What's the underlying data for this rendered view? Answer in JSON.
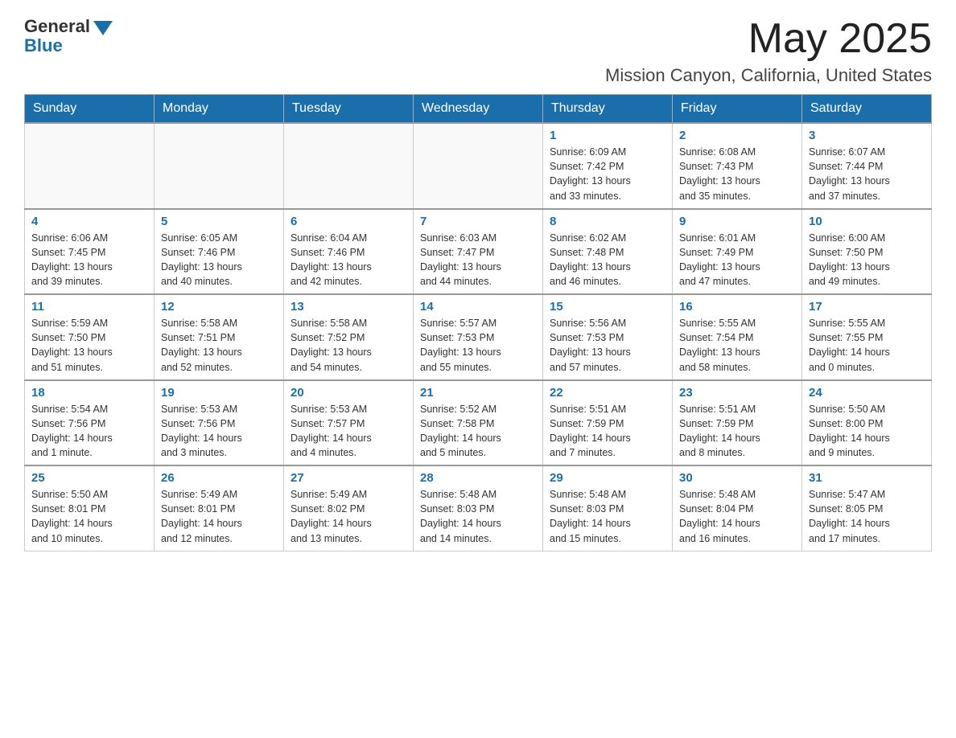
{
  "logo": {
    "general": "General",
    "blue": "Blue"
  },
  "header": {
    "month": "May 2025",
    "location": "Mission Canyon, California, United States"
  },
  "weekdays": [
    "Sunday",
    "Monday",
    "Tuesday",
    "Wednesday",
    "Thursday",
    "Friday",
    "Saturday"
  ],
  "weeks": [
    [
      {
        "day": "",
        "info": ""
      },
      {
        "day": "",
        "info": ""
      },
      {
        "day": "",
        "info": ""
      },
      {
        "day": "",
        "info": ""
      },
      {
        "day": "1",
        "info": "Sunrise: 6:09 AM\nSunset: 7:42 PM\nDaylight: 13 hours\nand 33 minutes."
      },
      {
        "day": "2",
        "info": "Sunrise: 6:08 AM\nSunset: 7:43 PM\nDaylight: 13 hours\nand 35 minutes."
      },
      {
        "day": "3",
        "info": "Sunrise: 6:07 AM\nSunset: 7:44 PM\nDaylight: 13 hours\nand 37 minutes."
      }
    ],
    [
      {
        "day": "4",
        "info": "Sunrise: 6:06 AM\nSunset: 7:45 PM\nDaylight: 13 hours\nand 39 minutes."
      },
      {
        "day": "5",
        "info": "Sunrise: 6:05 AM\nSunset: 7:46 PM\nDaylight: 13 hours\nand 40 minutes."
      },
      {
        "day": "6",
        "info": "Sunrise: 6:04 AM\nSunset: 7:46 PM\nDaylight: 13 hours\nand 42 minutes."
      },
      {
        "day": "7",
        "info": "Sunrise: 6:03 AM\nSunset: 7:47 PM\nDaylight: 13 hours\nand 44 minutes."
      },
      {
        "day": "8",
        "info": "Sunrise: 6:02 AM\nSunset: 7:48 PM\nDaylight: 13 hours\nand 46 minutes."
      },
      {
        "day": "9",
        "info": "Sunrise: 6:01 AM\nSunset: 7:49 PM\nDaylight: 13 hours\nand 47 minutes."
      },
      {
        "day": "10",
        "info": "Sunrise: 6:00 AM\nSunset: 7:50 PM\nDaylight: 13 hours\nand 49 minutes."
      }
    ],
    [
      {
        "day": "11",
        "info": "Sunrise: 5:59 AM\nSunset: 7:50 PM\nDaylight: 13 hours\nand 51 minutes."
      },
      {
        "day": "12",
        "info": "Sunrise: 5:58 AM\nSunset: 7:51 PM\nDaylight: 13 hours\nand 52 minutes."
      },
      {
        "day": "13",
        "info": "Sunrise: 5:58 AM\nSunset: 7:52 PM\nDaylight: 13 hours\nand 54 minutes."
      },
      {
        "day": "14",
        "info": "Sunrise: 5:57 AM\nSunset: 7:53 PM\nDaylight: 13 hours\nand 55 minutes."
      },
      {
        "day": "15",
        "info": "Sunrise: 5:56 AM\nSunset: 7:53 PM\nDaylight: 13 hours\nand 57 minutes."
      },
      {
        "day": "16",
        "info": "Sunrise: 5:55 AM\nSunset: 7:54 PM\nDaylight: 13 hours\nand 58 minutes."
      },
      {
        "day": "17",
        "info": "Sunrise: 5:55 AM\nSunset: 7:55 PM\nDaylight: 14 hours\nand 0 minutes."
      }
    ],
    [
      {
        "day": "18",
        "info": "Sunrise: 5:54 AM\nSunset: 7:56 PM\nDaylight: 14 hours\nand 1 minute."
      },
      {
        "day": "19",
        "info": "Sunrise: 5:53 AM\nSunset: 7:56 PM\nDaylight: 14 hours\nand 3 minutes."
      },
      {
        "day": "20",
        "info": "Sunrise: 5:53 AM\nSunset: 7:57 PM\nDaylight: 14 hours\nand 4 minutes."
      },
      {
        "day": "21",
        "info": "Sunrise: 5:52 AM\nSunset: 7:58 PM\nDaylight: 14 hours\nand 5 minutes."
      },
      {
        "day": "22",
        "info": "Sunrise: 5:51 AM\nSunset: 7:59 PM\nDaylight: 14 hours\nand 7 minutes."
      },
      {
        "day": "23",
        "info": "Sunrise: 5:51 AM\nSunset: 7:59 PM\nDaylight: 14 hours\nand 8 minutes."
      },
      {
        "day": "24",
        "info": "Sunrise: 5:50 AM\nSunset: 8:00 PM\nDaylight: 14 hours\nand 9 minutes."
      }
    ],
    [
      {
        "day": "25",
        "info": "Sunrise: 5:50 AM\nSunset: 8:01 PM\nDaylight: 14 hours\nand 10 minutes."
      },
      {
        "day": "26",
        "info": "Sunrise: 5:49 AM\nSunset: 8:01 PM\nDaylight: 14 hours\nand 12 minutes."
      },
      {
        "day": "27",
        "info": "Sunrise: 5:49 AM\nSunset: 8:02 PM\nDaylight: 14 hours\nand 13 minutes."
      },
      {
        "day": "28",
        "info": "Sunrise: 5:48 AM\nSunset: 8:03 PM\nDaylight: 14 hours\nand 14 minutes."
      },
      {
        "day": "29",
        "info": "Sunrise: 5:48 AM\nSunset: 8:03 PM\nDaylight: 14 hours\nand 15 minutes."
      },
      {
        "day": "30",
        "info": "Sunrise: 5:48 AM\nSunset: 8:04 PM\nDaylight: 14 hours\nand 16 minutes."
      },
      {
        "day": "31",
        "info": "Sunrise: 5:47 AM\nSunset: 8:05 PM\nDaylight: 14 hours\nand 17 minutes."
      }
    ]
  ]
}
